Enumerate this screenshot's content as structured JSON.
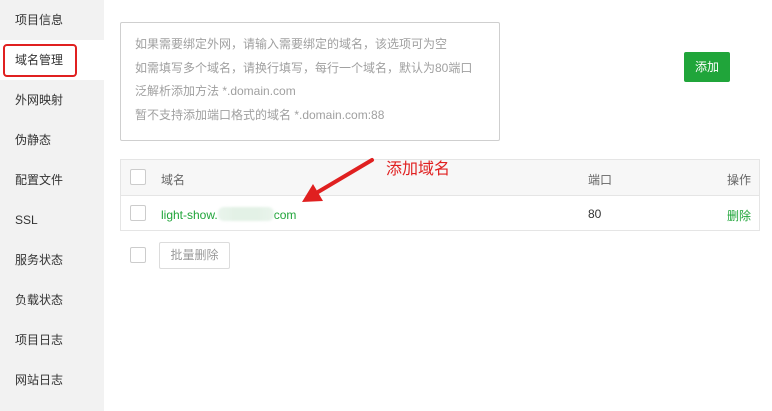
{
  "sidebar": {
    "items": [
      {
        "label": "项目信息"
      },
      {
        "label": "域名管理",
        "active": true
      },
      {
        "label": "外网映射"
      },
      {
        "label": "伪静态"
      },
      {
        "label": "配置文件"
      },
      {
        "label": "SSL"
      },
      {
        "label": "服务状态"
      },
      {
        "label": "负载状态"
      },
      {
        "label": "项目日志"
      },
      {
        "label": "网站日志"
      }
    ]
  },
  "domain_input": {
    "placeholder_lines": [
      "如果需要绑定外网，请输入需要绑定的域名，该选项可为空",
      "如需填写多个域名，请换行填写，每行一个域名，默认为80端口",
      "泛解析添加方法 *.domain.com",
      "暂不支持添加端口格式的域名 *.domain.com:88"
    ],
    "value": ""
  },
  "add_button": {
    "label": "添加"
  },
  "table": {
    "headers": {
      "domain": "域名",
      "port": "端口",
      "action": "操作"
    },
    "rows": [
      {
        "domain_prefix": "light-show.",
        "domain_suffix": "com",
        "port": "80",
        "action": "删除"
      }
    ]
  },
  "batch_delete": {
    "label": "批量删除"
  },
  "annotation": {
    "text": "添加域名",
    "color": "#e02020"
  },
  "colors": {
    "accent": "#20a53a",
    "sidebar_bg": "#f2f2f2",
    "annotation_red": "#e02020"
  }
}
